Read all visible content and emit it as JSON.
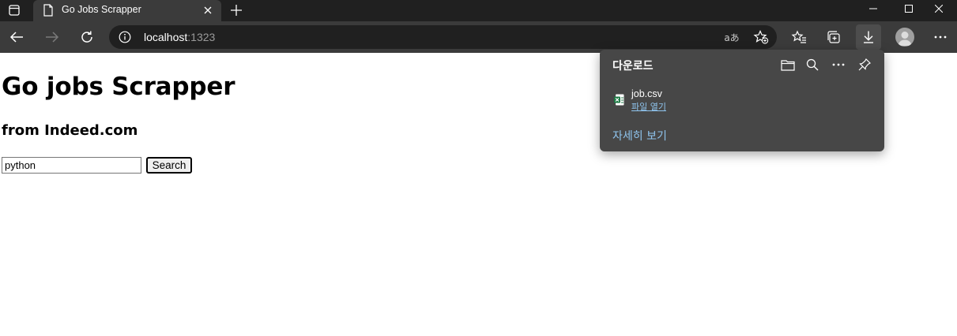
{
  "browser": {
    "tab": {
      "title": "Go Jobs Scrapper",
      "favicon": "page-icon"
    },
    "address": {
      "host": "localhost",
      "port": ":1323"
    },
    "read_aloud_glyph": "aあ"
  },
  "page": {
    "title": "Go jobs Scrapper",
    "subtitle": "from Indeed.com",
    "search": {
      "value": "python",
      "button_label": "Search"
    }
  },
  "downloads": {
    "title": "다운로드",
    "items": [
      {
        "file_name": "job.csv",
        "action_label": "파일 열기",
        "icon": "excel-file-icon"
      }
    ],
    "more_label": "자세히 보기"
  },
  "colors": {
    "tabstrip": "#202020",
    "toolbar": "#3b3b3b",
    "flyout": "#474747",
    "link": "#8fc4ee"
  }
}
